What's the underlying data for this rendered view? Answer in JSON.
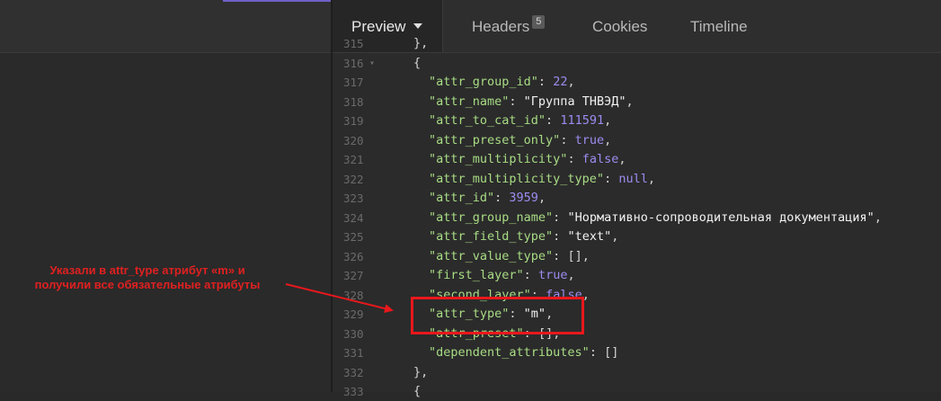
{
  "tabs": {
    "preview": "Preview",
    "headers": "Headers",
    "headers_count": "5",
    "cookies": "Cookies",
    "timeline": "Timeline"
  },
  "code_lines": [
    {
      "num": "315",
      "fold": "",
      "indent": 0,
      "parts": [
        {
          "t": "punc",
          "v": "},"
        }
      ]
    },
    {
      "num": "316",
      "fold": "▾",
      "indent": 0,
      "parts": [
        {
          "t": "punc",
          "v": "{"
        }
      ]
    },
    {
      "num": "317",
      "fold": "",
      "indent": 1,
      "parts": [
        {
          "t": "key",
          "v": "\"attr_group_id\""
        },
        {
          "t": "punc",
          "v": ": "
        },
        {
          "t": "num",
          "v": "22"
        },
        {
          "t": "punc",
          "v": ","
        }
      ]
    },
    {
      "num": "318",
      "fold": "",
      "indent": 1,
      "parts": [
        {
          "t": "key",
          "v": "\"attr_name\""
        },
        {
          "t": "punc",
          "v": ": "
        },
        {
          "t": "str",
          "v": "\"Группа ТНВЭД\""
        },
        {
          "t": "punc",
          "v": ","
        }
      ]
    },
    {
      "num": "319",
      "fold": "",
      "indent": 1,
      "parts": [
        {
          "t": "key",
          "v": "\"attr_to_cat_id\""
        },
        {
          "t": "punc",
          "v": ": "
        },
        {
          "t": "num",
          "v": "111591"
        },
        {
          "t": "punc",
          "v": ","
        }
      ]
    },
    {
      "num": "320",
      "fold": "",
      "indent": 1,
      "parts": [
        {
          "t": "key",
          "v": "\"attr_preset_only\""
        },
        {
          "t": "punc",
          "v": ": "
        },
        {
          "t": "kw",
          "v": "true"
        },
        {
          "t": "punc",
          "v": ","
        }
      ]
    },
    {
      "num": "321",
      "fold": "",
      "indent": 1,
      "parts": [
        {
          "t": "key",
          "v": "\"attr_multiplicity\""
        },
        {
          "t": "punc",
          "v": ": "
        },
        {
          "t": "kw",
          "v": "false"
        },
        {
          "t": "punc",
          "v": ","
        }
      ]
    },
    {
      "num": "322",
      "fold": "",
      "indent": 1,
      "parts": [
        {
          "t": "key",
          "v": "\"attr_multiplicity_type\""
        },
        {
          "t": "punc",
          "v": ": "
        },
        {
          "t": "kw",
          "v": "null"
        },
        {
          "t": "punc",
          "v": ","
        }
      ]
    },
    {
      "num": "323",
      "fold": "",
      "indent": 1,
      "parts": [
        {
          "t": "key",
          "v": "\"attr_id\""
        },
        {
          "t": "punc",
          "v": ": "
        },
        {
          "t": "num",
          "v": "3959"
        },
        {
          "t": "punc",
          "v": ","
        }
      ]
    },
    {
      "num": "324",
      "fold": "",
      "indent": 1,
      "parts": [
        {
          "t": "key",
          "v": "\"attr_group_name\""
        },
        {
          "t": "punc",
          "v": ": "
        },
        {
          "t": "str",
          "v": "\"Нормативно-сопроводительная документация\""
        },
        {
          "t": "punc",
          "v": ","
        }
      ]
    },
    {
      "num": "325",
      "fold": "",
      "indent": 1,
      "parts": [
        {
          "t": "key",
          "v": "\"attr_field_type\""
        },
        {
          "t": "punc",
          "v": ": "
        },
        {
          "t": "str",
          "v": "\"text\""
        },
        {
          "t": "punc",
          "v": ","
        }
      ]
    },
    {
      "num": "326",
      "fold": "",
      "indent": 1,
      "parts": [
        {
          "t": "key",
          "v": "\"attr_value_type\""
        },
        {
          "t": "punc",
          "v": ": "
        },
        {
          "t": "punc",
          "v": "[]"
        },
        {
          "t": "punc",
          "v": ","
        }
      ]
    },
    {
      "num": "327",
      "fold": "",
      "indent": 1,
      "parts": [
        {
          "t": "key",
          "v": "\"first_layer\""
        },
        {
          "t": "punc",
          "v": ": "
        },
        {
          "t": "kw",
          "v": "true"
        },
        {
          "t": "punc",
          "v": ","
        }
      ]
    },
    {
      "num": "328",
      "fold": "",
      "indent": 1,
      "parts": [
        {
          "t": "key",
          "v": "\"second_layer\""
        },
        {
          "t": "punc",
          "v": ": "
        },
        {
          "t": "kw",
          "v": "false"
        },
        {
          "t": "punc",
          "v": ","
        }
      ]
    },
    {
      "num": "329",
      "fold": "",
      "indent": 1,
      "parts": [
        {
          "t": "key",
          "v": "\"attr_type\""
        },
        {
          "t": "punc",
          "v": ": "
        },
        {
          "t": "str",
          "v": "\"m\""
        },
        {
          "t": "punc",
          "v": ","
        }
      ]
    },
    {
      "num": "330",
      "fold": "",
      "indent": 1,
      "parts": [
        {
          "t": "key",
          "v": "\"attr_preset\""
        },
        {
          "t": "punc",
          "v": ": "
        },
        {
          "t": "punc",
          "v": "[]"
        },
        {
          "t": "punc",
          "v": ","
        }
      ]
    },
    {
      "num": "331",
      "fold": "",
      "indent": 1,
      "parts": [
        {
          "t": "key",
          "v": "\"dependent_attributes\""
        },
        {
          "t": "punc",
          "v": ": "
        },
        {
          "t": "punc",
          "v": "[]"
        }
      ]
    },
    {
      "num": "332",
      "fold": "",
      "indent": 0,
      "parts": [
        {
          "t": "punc",
          "v": "},"
        }
      ]
    },
    {
      "num": "333",
      "fold": "",
      "indent": 0,
      "parts": [
        {
          "t": "punc",
          "v": "{"
        }
      ]
    }
  ],
  "annotation": {
    "line1": "Указали в attr_type  атрибут «m»  и",
    "line2": "получили все обязательные атрибуты",
    "color": "#e02020"
  },
  "colors": {
    "key": "#a8dc84",
    "string": "#f2f2f2",
    "number": "#9d8cf0",
    "highlight": "#e8181c"
  }
}
